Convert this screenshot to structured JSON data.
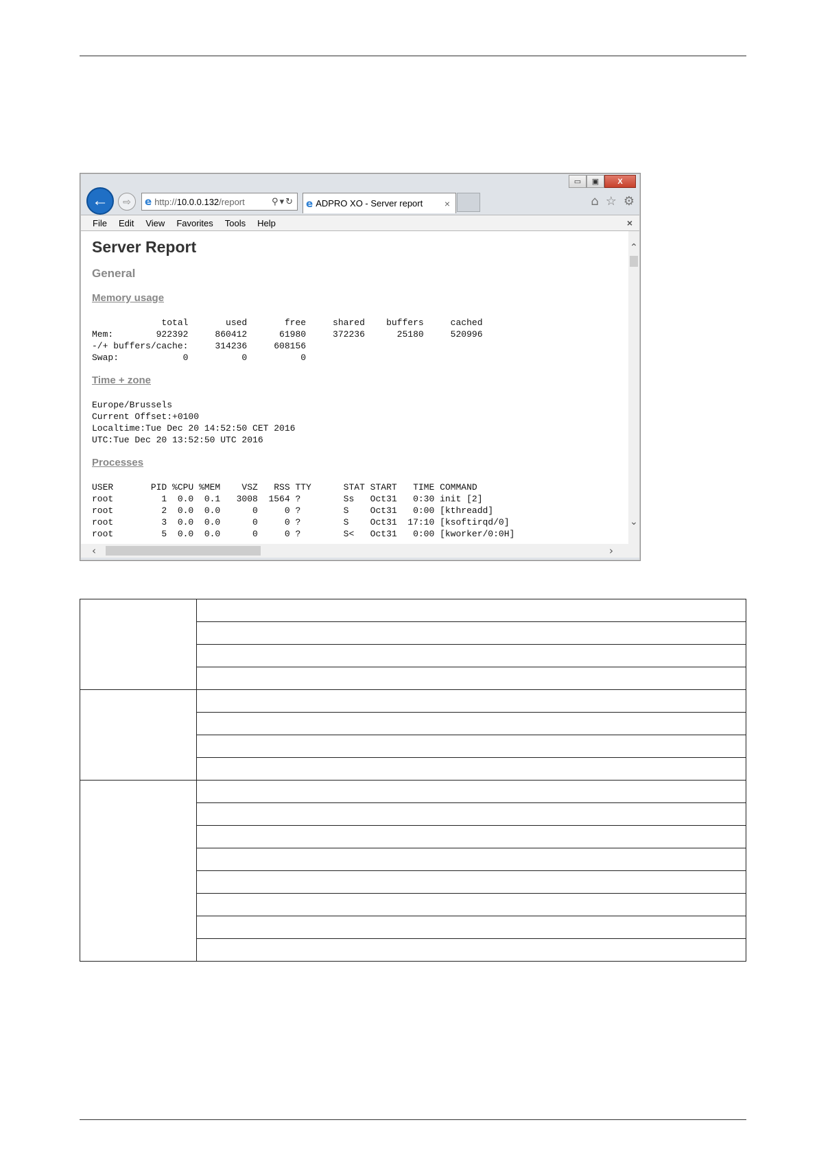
{
  "browser": {
    "window_buttons": {
      "minimize": "▭",
      "maximize": "▣",
      "close": "X"
    },
    "address": {
      "prefix": "http://",
      "host": "10.0.0.132",
      "path": "/report"
    },
    "tab": {
      "title": "ADPRO XO - Server report",
      "close": "×"
    },
    "menu": [
      "File",
      "Edit",
      "View",
      "Favorites",
      "Tools",
      "Help"
    ],
    "menu_close": "×"
  },
  "report": {
    "title": "Server Report",
    "general": "General",
    "memory_heading": "Memory usage",
    "memory_text": "             total       used       free     shared    buffers     cached\nMem:        922392     860412      61980     372236      25180     520996\n-/+ buffers/cache:     314236     608156\nSwap:            0          0          0",
    "time_heading": "Time + zone",
    "time_text": "Europe/Brussels\nCurrent Offset:+0100\nLocaltime:Tue Dec 20 14:52:50 CET 2016\nUTC:Tue Dec 20 13:52:50 UTC 2016",
    "processes_heading": "Processes",
    "processes_text": "USER       PID %CPU %MEM    VSZ   RSS TTY      STAT START   TIME COMMAND\nroot         1  0.0  0.1   3008  1564 ?        Ss   Oct31   0:30 init [2]\nroot         2  0.0  0.0      0     0 ?        S    Oct31   0:00 [kthreadd]\nroot         3  0.0  0.0      0     0 ?        S    Oct31  17:10 [ksoftirqd/0]\nroot         5  0.0  0.0      0     0 ?        S<   Oct31   0:00 [kworker/0:0H]"
  },
  "table": {
    "groups": [
      {
        "label": "",
        "rows": [
          "",
          "",
          "",
          ""
        ]
      },
      {
        "label": "",
        "rows": [
          "",
          "",
          "",
          ""
        ]
      },
      {
        "label": "",
        "rows": [
          "",
          "",
          "",
          "",
          "",
          "",
          "",
          ""
        ]
      }
    ]
  }
}
